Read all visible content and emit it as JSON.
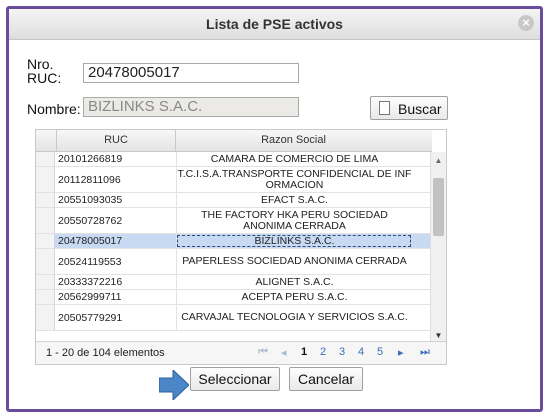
{
  "dialog": {
    "title": "Lista de PSE activos",
    "close_label": "⊗"
  },
  "form": {
    "ruc_label_line1": "Nro.",
    "ruc_label_line2": "RUC:",
    "ruc_value": "20478005017",
    "nombre_label": "Nombre:",
    "nombre_value": "BIZLINKS S.A.C.",
    "buscar_label": "Buscar"
  },
  "grid": {
    "headers": [
      "RUC",
      "Razon Social"
    ],
    "rows": [
      {
        "ruc": "20101266819",
        "name": "CAMARA DE COMERCIO DE LIMA"
      },
      {
        "ruc": "20112811096",
        "name": "T.C.I.S.A.TRANSPORTE CONFIDENCIAL DE INF ORMACION"
      },
      {
        "ruc": "20551093035",
        "name": "EFACT S.A.C."
      },
      {
        "ruc": "20550728762",
        "name": "THE FACTORY HKA PERU SOCIEDAD ANONIMA CERRADA"
      },
      {
        "ruc": "20478005017",
        "name": "BIZLINKS S.A.C.",
        "selected": true
      },
      {
        "ruc": "20524119553",
        "name": "PAPERLESS SOCIEDAD ANONIMA CERRADA"
      },
      {
        "ruc": "20333372216",
        "name": "ALIGNET S.A.C."
      },
      {
        "ruc": "20562999711",
        "name": "ACEPTA PERU S.A.C."
      },
      {
        "ruc": "20505779291",
        "name": "CARVAJAL TECNOLOGIA Y SERVICIOS S.A.C."
      }
    ]
  },
  "pager": {
    "info": "1 - 20 de 104 elementos",
    "first": "⏮",
    "prev": "◂",
    "pages": [
      "1",
      "2",
      "3",
      "4",
      "5"
    ],
    "current": "1",
    "next": "▸",
    "last": "⏭"
  },
  "footer": {
    "select_label": "Seleccionar",
    "cancel_label": "Cancelar"
  },
  "colors": {
    "frame": "#6a4c9c",
    "selected_row": "#c7daf2",
    "arrow": "#4a86c8"
  }
}
